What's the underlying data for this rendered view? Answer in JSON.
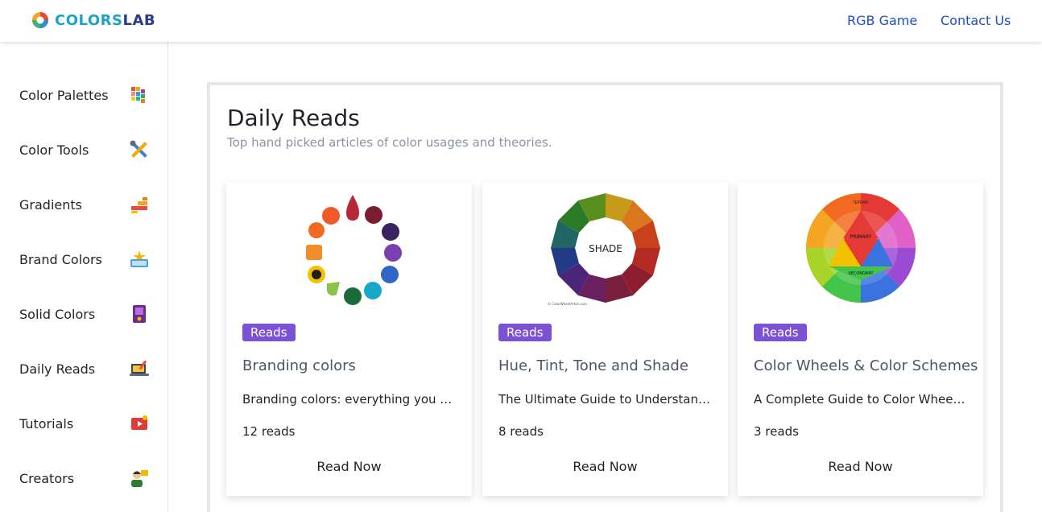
{
  "header": {
    "logo_part1": "COLORS",
    "logo_part2": "LAB",
    "nav": [
      {
        "label": "RGB Game"
      },
      {
        "label": "Contact Us"
      }
    ]
  },
  "sidebar": {
    "items": [
      {
        "label": "Color Palettes",
        "icon": "palette-grid-icon"
      },
      {
        "label": "Color Tools",
        "icon": "tools-icon"
      },
      {
        "label": "Gradients",
        "icon": "gradient-icon"
      },
      {
        "label": "Brand Colors",
        "icon": "brand-badge-icon"
      },
      {
        "label": "Solid Colors",
        "icon": "solid-color-icon"
      },
      {
        "label": "Daily Reads",
        "icon": "laptop-read-icon"
      },
      {
        "label": "Tutorials",
        "icon": "video-icon"
      },
      {
        "label": "Creators",
        "icon": "creator-icon"
      }
    ]
  },
  "main": {
    "title": "Daily Reads",
    "subtitle": "Top hand picked articles of color usages and theories.",
    "cards": [
      {
        "badge": "Reads",
        "title": "Branding colors",
        "description": "Branding colors: everything you need to know",
        "reads": "12 reads",
        "button": "Read Now",
        "image": "brand-logos-circle"
      },
      {
        "badge": "Reads",
        "title": "Hue, Tint, Tone and Shade",
        "description": "The Ultimate Guide to Understanding Hue, Tint, Tone and Shade",
        "reads": "8 reads",
        "button": "Read Now",
        "image": "shade-color-wheel",
        "image_center_label": "SHADE",
        "image_credit": "© ColorWheelArtist.com"
      },
      {
        "badge": "Reads",
        "title": "Color Wheels & Color Schemes",
        "description": "A Complete Guide to Color Wheels & Color Schemes",
        "reads": "3 reads",
        "button": "Read Now",
        "image": "primary-secondary-tertiary-wheel",
        "wheel_labels": {
          "primary": "PRIMARY",
          "secondary": "SECONDARY",
          "tertiary": "TERTIARY"
        }
      }
    ]
  },
  "colors": {
    "accent_badge": "#7b52d4",
    "nav_link": "#1e4fc2",
    "logo_primary": "#1fa3c5",
    "logo_secondary": "#2d3a8c"
  }
}
